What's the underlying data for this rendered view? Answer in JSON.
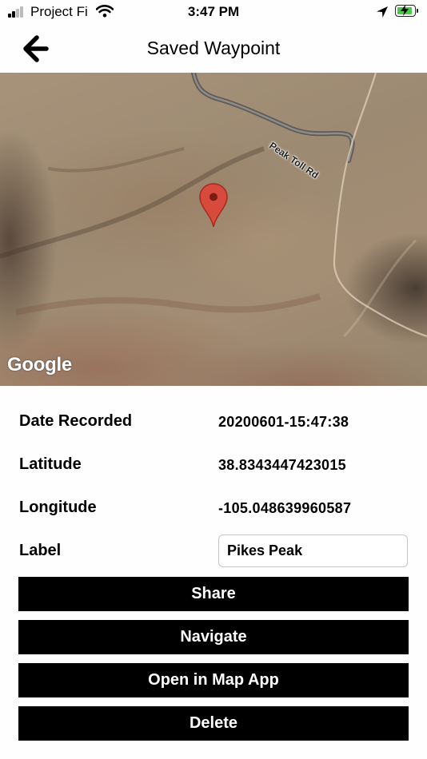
{
  "status_bar": {
    "carrier": "Project Fi",
    "time": "3:47 PM",
    "battery_color": "#49c94a"
  },
  "nav": {
    "title": "Saved Waypoint",
    "back_icon": "chevron-left-icon"
  },
  "map": {
    "road_label": "Peak Toll Rd",
    "attribution": "Google",
    "pin_color": "#d84a3b"
  },
  "details": {
    "rows": [
      {
        "label": "Date Recorded",
        "value": "20200601-15:47:38"
      },
      {
        "label": "Latitude",
        "value": "38.8343447423015"
      },
      {
        "label": "Longitude",
        "value": "-105.048639960587"
      }
    ],
    "label_field": {
      "label": "Label",
      "value": "Pikes Peak"
    }
  },
  "actions": {
    "share": "Share",
    "navigate": "Navigate",
    "open_map": "Open in Map App",
    "delete": "Delete"
  }
}
